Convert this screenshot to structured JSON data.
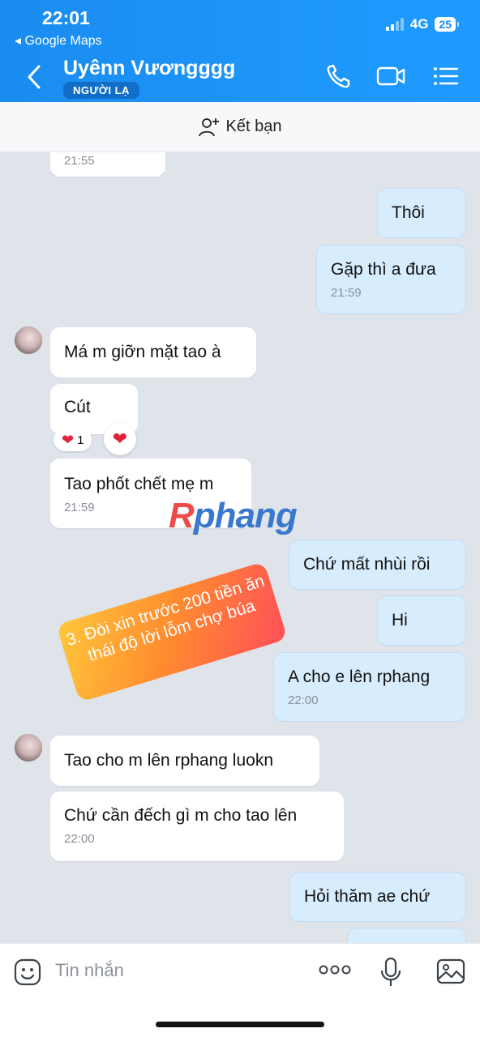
{
  "status_bar": {
    "time": "22:01",
    "back_app": "◂ Google Maps",
    "network": "4G",
    "battery": "25"
  },
  "header": {
    "contact_name": "Uyênn Vươngggg",
    "badge": "NGƯỜI LẠ",
    "icons": [
      "back-chevron-icon",
      "phone-icon",
      "video-call-icon",
      "menu-list-icon"
    ]
  },
  "friend_bar": {
    "label": "Kết bạn",
    "icon": "add-person-icon"
  },
  "messages": {
    "m0_time": "21:55",
    "m1_text": "Thôi",
    "m2_text": "Gặp thì a đưa",
    "m2_time": "21:59",
    "m3_text": "Má m giỡn mặt tao à",
    "m4_text": "Cút",
    "m4_react_count": "1",
    "m5_text": "Tao phốt chết mẹ m",
    "m5_time": "21:59",
    "m6_text": "Chứ mất nhùi rồi",
    "m7_text": "Hi",
    "m8_text": "A cho e lên rphang",
    "m8_time": "22:00",
    "m9_text": "Tao cho m lên rphang luokn",
    "m10_text": "Chứ cần đếch gì m cho tao lên",
    "m10_time": "22:00",
    "m11_text": "Hỏi thăm ae chứ"
  },
  "overlay": {
    "watermark": "Rphang",
    "annotation": "3. Đòi xin trước 200 tiền ăn thái độ lời lỗm chợ búa"
  },
  "input": {
    "placeholder": "Tin nhắn"
  },
  "colors": {
    "header_blue": "#1a8cf0",
    "outgoing_bubble": "#d7ecfd",
    "incoming_bubble": "#ffffff",
    "chat_background": "#dfe3ea",
    "heart_red": "#e0243b"
  }
}
